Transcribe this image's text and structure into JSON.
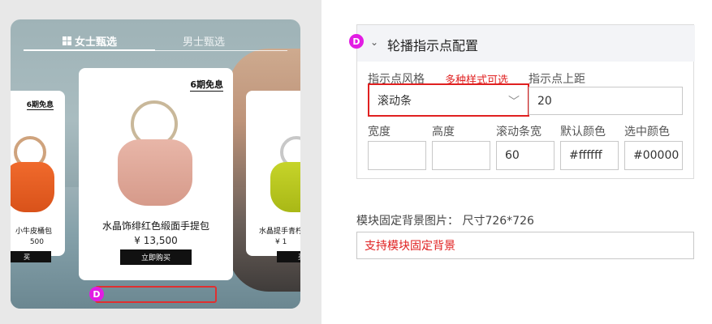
{
  "preview": {
    "tabs": [
      {
        "label": "女士甄选",
        "icon": "grid-icon"
      },
      {
        "label": "男士甄选"
      }
    ],
    "cards": {
      "left": {
        "installment": "6期免息",
        "name": "小牛皮桶包",
        "price": "500",
        "buy": "买"
      },
      "center": {
        "installment": "6期免息",
        "name": "水晶饰绯红色缎面手提包",
        "price": "¥ 13,500",
        "buy": "立即购买"
      },
      "right": {
        "name": "水晶提手青柠",
        "price": "¥ 1",
        "buy": "买"
      }
    },
    "badge": "D"
  },
  "config": {
    "badge": "D",
    "title": "轮播指示点配置",
    "style_label": "指示点风格",
    "style_note": "多种样式可选",
    "style_value": "滚动条",
    "top_margin_label": "指示点上距",
    "top_margin_value": "20",
    "width_label": "宽度",
    "width_value": "",
    "height_label": "高度",
    "height_value": "",
    "bar_width_label": "滚动条宽",
    "bar_width_value": "60",
    "default_color_label": "默认颜色",
    "default_color_value": "#ffffff",
    "selected_color_label": "选中颜色",
    "selected_color_value": "#00000"
  },
  "background": {
    "label": "模块固定背景图片：  尺寸726*726",
    "value": "支持模块固定背景"
  }
}
